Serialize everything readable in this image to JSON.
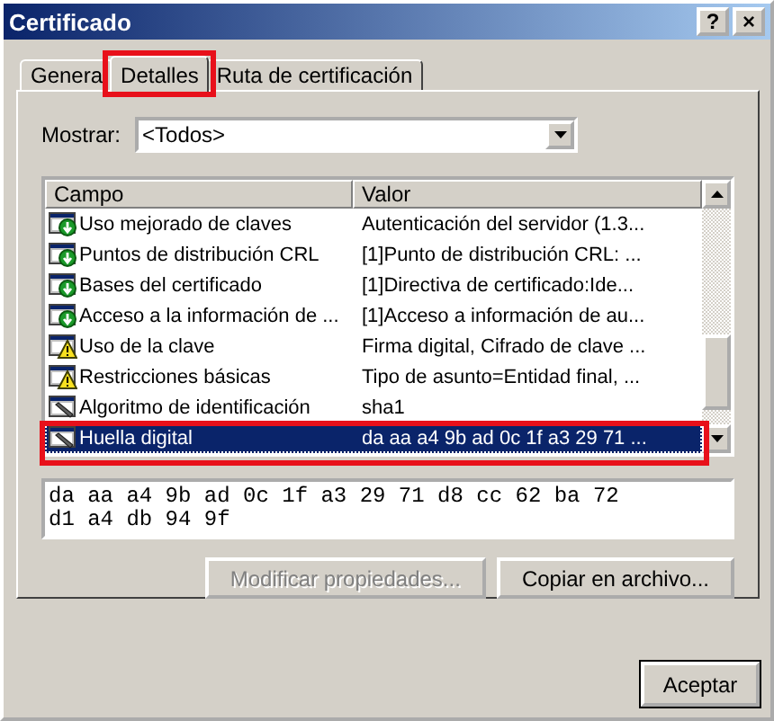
{
  "window": {
    "title": "Certificado",
    "controls": [
      "?",
      "×"
    ]
  },
  "tabs": [
    {
      "label": "Genera",
      "selected": false,
      "highlighted": false
    },
    {
      "label": "Detalles",
      "selected": true,
      "highlighted": true
    },
    {
      "label": "Ruta de certificación",
      "selected": false,
      "highlighted": false
    }
  ],
  "show": {
    "label": "Mostrar:",
    "value": "<Todos>"
  },
  "list": {
    "columns": [
      "Campo",
      "Valor"
    ],
    "rows": [
      {
        "kind": "extension",
        "field": "Uso mejorado de claves",
        "value": "Autenticación del servidor (1.3...",
        "selected": false,
        "highlighted": false
      },
      {
        "kind": "extension",
        "field": "Puntos de distribución CRL",
        "value": "[1]Punto de distribución CRL: ...",
        "selected": false,
        "highlighted": false
      },
      {
        "kind": "extension",
        "field": "Bases del certificado",
        "value": "[1]Directiva de certificado:Ide...",
        "selected": false,
        "highlighted": false
      },
      {
        "kind": "extension",
        "field": "Acceso a la información de ...",
        "value": "[1]Acceso a información de au...",
        "selected": false,
        "highlighted": false
      },
      {
        "kind": "critical",
        "field": "Uso de la clave",
        "value": "Firma digital, Cifrado de clave ...",
        "selected": false,
        "highlighted": false
      },
      {
        "kind": "critical",
        "field": "Restricciones básicas",
        "value": "Tipo de asunto=Entidad final, ...",
        "selected": false,
        "highlighted": false
      },
      {
        "kind": "property",
        "field": "Algoritmo de identificación",
        "value": "sha1",
        "selected": false,
        "highlighted": false
      },
      {
        "kind": "property",
        "field": "Huella digital",
        "value": "da aa a4 9b ad 0c 1f a3 29 71 ...",
        "selected": true,
        "highlighted": true
      }
    ]
  },
  "detail": {
    "lines": [
      "da aa a4 9b ad 0c 1f a3 29 71 d8 cc 62 ba 72",
      "d1 a4 db 94 9f"
    ]
  },
  "buttons": [
    {
      "label": "Modificar propiedades...",
      "disabled": true
    },
    {
      "label": "Copiar en archivo...",
      "disabled": false
    }
  ],
  "ok_button": "Aceptar"
}
